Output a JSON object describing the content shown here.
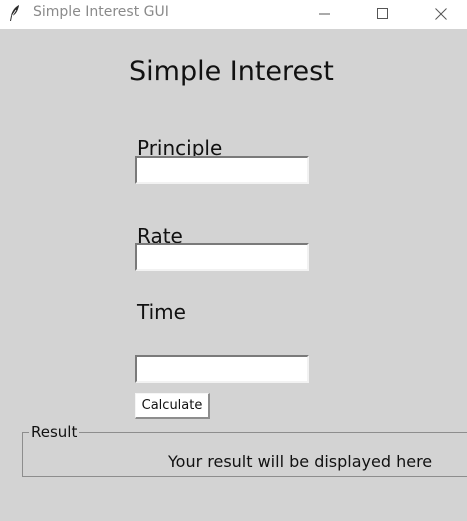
{
  "window": {
    "title": "Simple Interest GUI",
    "icon": "feather-icon"
  },
  "form": {
    "heading": "Simple Interest",
    "principle_label": "Principle",
    "principle_value": "",
    "rate_label": "Rate",
    "rate_value": "",
    "time_label": "Time",
    "time_value": "",
    "calculate_label": "Calculate"
  },
  "result": {
    "legend": "Result",
    "text": "Your result will be displayed here"
  },
  "colors": {
    "background": "#d3d3d3",
    "titlebar": "#ffffff",
    "entry": "#ffffff"
  }
}
